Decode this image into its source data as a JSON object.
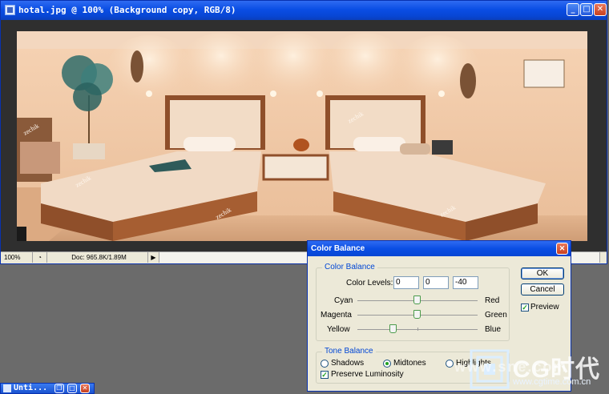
{
  "document": {
    "title": "hotal.jpg @ 100% (Background copy, RGB/8)",
    "zoom": "100%",
    "doc_info": "Doc: 965.8K/1.89M",
    "watermark_text": "zechik"
  },
  "dialog": {
    "title": "Color Balance",
    "color_balance_group": "Color Balance",
    "color_levels_label": "Color Levels:",
    "levels": [
      "0",
      "0",
      "-40"
    ],
    "sliders": [
      {
        "left": "Cyan",
        "right": "Red",
        "value": 0
      },
      {
        "left": "Magenta",
        "right": "Green",
        "value": 0
      },
      {
        "left": "Yellow",
        "right": "Blue",
        "value": -40
      }
    ],
    "tone_balance_group": "Tone Balance",
    "tone_options": [
      {
        "label": "Shadows",
        "selected": false
      },
      {
        "label": "Midtones",
        "selected": true
      },
      {
        "label": "Highlights",
        "selected": false
      }
    ],
    "preserve_luminosity": "Preserve Luminosity",
    "preserve_checked": true,
    "ok_label": "OK",
    "cancel_label": "Cancel",
    "preview_label": "Preview",
    "preview_checked": true
  },
  "taskbar": {
    "title": "Unti..."
  },
  "overlay_watermark": {
    "brand": "CG时代",
    "mid": "www.sne.com",
    "url": "www.cgtime.com.cn"
  },
  "colors": {
    "title_blue": "#0a4ee4",
    "group_label_blue": "#0046d5",
    "dialog_bg": "#ece9d8",
    "slider_green": "#4a9a4a"
  }
}
